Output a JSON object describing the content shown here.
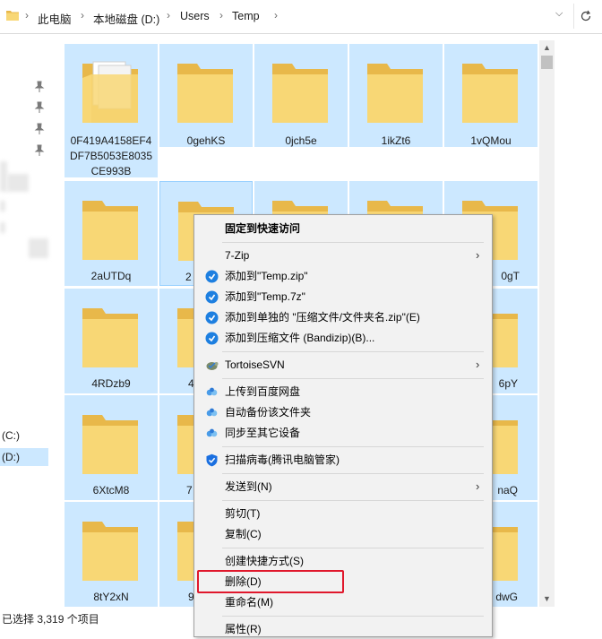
{
  "breadcrumb": [
    "此电脑",
    "本地磁盘 (D:)",
    "Users",
    "Temp"
  ],
  "nav": {
    "drives": [
      "(C:)",
      "(D:)"
    ]
  },
  "files": [
    {
      "name": "0F419A4158EF4DF7B5053E8035CE993B"
    },
    {
      "name": "0gehKS"
    },
    {
      "name": "0jch5e"
    },
    {
      "name": "1ikZt6"
    },
    {
      "name": "1vQMou"
    },
    {
      "name": "2aUTDq"
    },
    {
      "name": "2"
    },
    {
      "name": ""
    },
    {
      "name": ""
    },
    {
      "name": "0gT"
    },
    {
      "name": "4RDzb9"
    },
    {
      "name": "4"
    },
    {
      "name": "6pY"
    },
    {
      "name": "6XtcM8"
    },
    {
      "name": "7"
    },
    {
      "name": "naQ"
    },
    {
      "name": "8tY2xN"
    },
    {
      "name": "9"
    },
    {
      "name": "dwG"
    }
  ],
  "status": {
    "text": "已选择 3,319 个项目"
  },
  "context_menu": {
    "pin": "固定到快速访问",
    "zip7": "7-Zip",
    "add_temp_zip": "添加到\"Temp.zip\"",
    "add_temp_7z": "添加到\"Temp.7z\"",
    "add_separate": "添加到单独的 \"压缩文件/文件夹名.zip\"(E)",
    "add_bandizip": "添加到压缩文件 (Bandizip)(B)...",
    "tortoise": "TortoiseSVN",
    "upload_baidu": "上传到百度网盘",
    "auto_backup": "自动备份该文件夹",
    "sync_devices": "同步至其它设备",
    "scan_virus": "扫描病毒(腾讯电脑管家)",
    "send_to": "发送到(N)",
    "cut": "剪切(T)",
    "copy": "复制(C)",
    "create_shortcut": "创建快捷方式(S)",
    "delete": "删除(D)",
    "rename": "重命名(M)",
    "properties": "属性(R)"
  },
  "colors": {
    "selection": "#cce8ff",
    "highlight_box": "#e0182c",
    "folder": "#f8d775"
  }
}
